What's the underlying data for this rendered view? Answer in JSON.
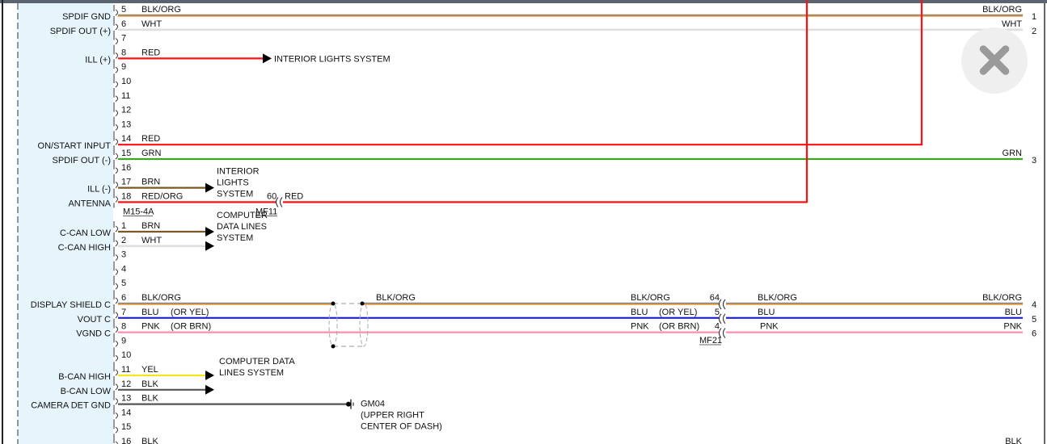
{
  "connectors": {
    "a": {
      "name": "M15-4A",
      "splice_name": "MF11",
      "splice_pin": "60",
      "splice_wire": "RED"
    },
    "b": {
      "splice_name": "MF21"
    }
  },
  "pins_a": [
    {
      "pin": "5",
      "label": "SPDIF GND",
      "wire": "BLK/ORG",
      "hex": "#d98a2b",
      "route": "right",
      "right_label": "BLK/ORG",
      "right_pin": "1"
    },
    {
      "pin": "6",
      "label": "SPDIF OUT (+)",
      "wire": "WHT",
      "hex": "#dedede",
      "route": "right",
      "right_label": "WHT",
      "right_pin": "2"
    },
    {
      "pin": "7"
    },
    {
      "pin": "8",
      "label": "ILL (+)",
      "wire": "RED",
      "hex": "#ff1010",
      "route": "arrow-long",
      "dest": [
        "INTERIOR LIGHTS SYSTEM"
      ]
    },
    {
      "pin": "9"
    },
    {
      "pin": "10"
    },
    {
      "pin": "11"
    },
    {
      "pin": "12"
    },
    {
      "pin": "13"
    },
    {
      "pin": "14",
      "label": "ON/START INPUT",
      "wire": "RED",
      "hex": "#ff1010",
      "route": "up1"
    },
    {
      "pin": "15",
      "label": "SPDIF OUT (-)",
      "wire": "GRN",
      "hex": "#3aa81f",
      "route": "right",
      "right_label": "GRN",
      "right_pin": "3"
    },
    {
      "pin": "16"
    },
    {
      "pin": "17",
      "label": "ILL (-)",
      "wire": "BRN",
      "hex": "#7a5a20",
      "route": "arrow",
      "dest": [
        "INTERIOR",
        "LIGHTS",
        "SYSTEM"
      ]
    },
    {
      "pin": "18",
      "label": "ANTENNA",
      "wire": "RED/ORG",
      "hex": "#ff1010",
      "route": "splice-up"
    }
  ],
  "pins_b": [
    {
      "pin": "1",
      "label": "C-CAN LOW",
      "wire": "BRN",
      "hex": "#7a5a20",
      "route": "arrow",
      "dest": [
        "COMPUTER",
        "DATA LINES",
        "SYSTEM"
      ]
    },
    {
      "pin": "2",
      "label": "C-CAN HIGH",
      "wire": "WHT",
      "hex": "#dedede",
      "route": "arrow"
    },
    {
      "pin": "3"
    },
    {
      "pin": "4"
    },
    {
      "pin": "5"
    },
    {
      "pin": "6",
      "label": "DISPLAY SHIELD C",
      "wire": "BLK/ORG",
      "hex": "#d98a2b",
      "route": "shielded",
      "mid_label": "BLK/ORG",
      "mid2_label": "BLK/ORG",
      "splice_pin": "64",
      "after_label": "BLK/ORG",
      "right_label": "BLK/ORG",
      "right_pin": "4"
    },
    {
      "pin": "7",
      "label": "VOUT C",
      "wire": "BLU",
      "alt": "(OR YEL)",
      "hex": "#1a1aff",
      "route": "shielded",
      "mid2_label": "BLU",
      "mid2_alt": "(OR YEL)",
      "splice_pin": "5",
      "after_label": "BLU",
      "right_label": "BLU",
      "right_pin": "5"
    },
    {
      "pin": "8",
      "label": "VGND C",
      "wire": "PNK",
      "alt": "(OR BRN)",
      "hex": "#ff8fa8",
      "route": "shielded",
      "mid2_label": "PNK",
      "mid2_alt": "(OR BRN)",
      "splice_pin": "4",
      "after_label": "PNK",
      "right_label": "PNK",
      "right_pin": "6"
    },
    {
      "pin": "9"
    },
    {
      "pin": "10"
    },
    {
      "pin": "11",
      "label": "B-CAN HIGH",
      "wire": "YEL",
      "hex": "#f5e61a",
      "route": "arrow",
      "dest": [
        "COMPUTER DATA",
        "LINES SYSTEM"
      ]
    },
    {
      "pin": "12",
      "label": "B-CAN LOW",
      "wire": "BLK",
      "hex": "#555555",
      "route": "arrow"
    },
    {
      "pin": "13",
      "label": "CAMERA DET GND",
      "wire": "BLK",
      "hex": "#555555",
      "route": "ground",
      "dest": [
        "GM04",
        "(UPPER RIGHT",
        "CENTER OF DASH)"
      ]
    },
    {
      "pin": "14"
    },
    {
      "pin": "15"
    },
    {
      "pin": "16",
      "wire": "BLK",
      "hex": "#555555",
      "route": "partial",
      "right_label": "BLK"
    }
  ],
  "close_button": {
    "icon": "close-icon"
  }
}
